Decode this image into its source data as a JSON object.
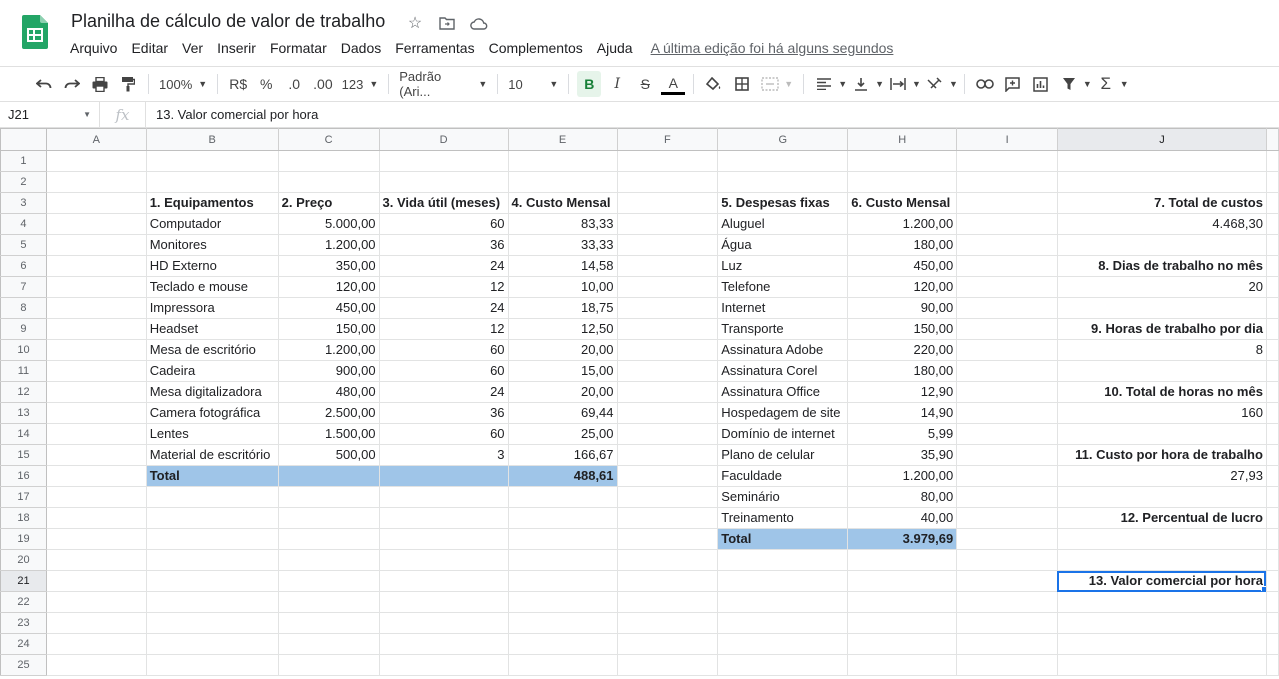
{
  "doc": {
    "title": "Planilha de cálculo de valor de trabalho",
    "last_edit": "A última edição foi há alguns segundos"
  },
  "menu": [
    "Arquivo",
    "Editar",
    "Ver",
    "Inserir",
    "Formatar",
    "Dados",
    "Ferramentas",
    "Complementos",
    "Ajuda"
  ],
  "toolbar": {
    "zoom": "100%",
    "currency": "R$",
    "percent": "%",
    "dec_less": ".0",
    "dec_more": ".00",
    "more_formats": "123",
    "font": "Padrão (Ari...",
    "font_size": "10",
    "bold": "B",
    "italic": "I",
    "strike": "S",
    "text_color": "A",
    "colors": {
      "accent": "#1a73e8",
      "total_fill": "#9fc5e8",
      "bold_active": "#188038"
    }
  },
  "formula_bar": {
    "cell_ref": "J21",
    "fx": "fx",
    "content": "13. Valor comercial por hora"
  },
  "columns": [
    "A",
    "B",
    "C",
    "D",
    "E",
    "F",
    "G",
    "H",
    "I",
    "J"
  ],
  "rows": [
    [
      "",
      "",
      "",
      "",
      "",
      "",
      "",
      "",
      "",
      ""
    ],
    [
      "",
      "",
      "",
      "",
      "",
      "",
      "",
      "",
      "",
      ""
    ],
    [
      "",
      "1. Equipamentos",
      "2. Preço",
      "3. Vida útil (meses)",
      "4. Custo Mensal",
      "",
      "5. Despesas fixas",
      "6. Custo Mensal",
      "",
      "7. Total de custos"
    ],
    [
      "",
      "Computador",
      "5.000,00",
      "60",
      "83,33",
      "",
      "Aluguel",
      "1.200,00",
      "",
      "4.468,30"
    ],
    [
      "",
      "Monitores",
      "1.200,00",
      "36",
      "33,33",
      "",
      "Água",
      "180,00",
      "",
      ""
    ],
    [
      "",
      "HD Externo",
      "350,00",
      "24",
      "14,58",
      "",
      "Luz",
      "450,00",
      "",
      "8. Dias de trabalho no mês"
    ],
    [
      "",
      "Teclado e mouse",
      "120,00",
      "12",
      "10,00",
      "",
      "Telefone",
      "120,00",
      "",
      "20"
    ],
    [
      "",
      "Impressora",
      "450,00",
      "24",
      "18,75",
      "",
      "Internet",
      "90,00",
      "",
      ""
    ],
    [
      "",
      "Headset",
      "150,00",
      "12",
      "12,50",
      "",
      "Transporte",
      "150,00",
      "",
      "9. Horas de trabalho por dia"
    ],
    [
      "",
      "Mesa de escritório",
      "1.200,00",
      "60",
      "20,00",
      "",
      "Assinatura Adobe",
      "220,00",
      "",
      "8"
    ],
    [
      "",
      "Cadeira",
      "900,00",
      "60",
      "15,00",
      "",
      "Assinatura Corel",
      "180,00",
      "",
      ""
    ],
    [
      "",
      "Mesa digitalizadora",
      "480,00",
      "24",
      "20,00",
      "",
      "Assinatura Office",
      "12,90",
      "",
      "10. Total de horas no mês"
    ],
    [
      "",
      "Camera fotográfica",
      "2.500,00",
      "36",
      "69,44",
      "",
      "Hospedagem de site",
      "14,90",
      "",
      "160"
    ],
    [
      "",
      "Lentes",
      "1.500,00",
      "60",
      "25,00",
      "",
      "Domínio de internet",
      "5,99",
      "",
      ""
    ],
    [
      "",
      "Material de escritório",
      "500,00",
      "3",
      "166,67",
      "",
      "Plano de celular",
      "35,90",
      "",
      "11. Custo por hora de trabalho"
    ],
    [
      "",
      "Total",
      "",
      "",
      "488,61",
      "",
      "Faculdade",
      "1.200,00",
      "",
      "27,93"
    ],
    [
      "",
      "",
      "",
      "",
      "",
      "",
      "Seminário",
      "80,00",
      "",
      ""
    ],
    [
      "",
      "",
      "",
      "",
      "",
      "",
      "Treinamento",
      "40,00",
      "",
      "12. Percentual de lucro"
    ],
    [
      "",
      "",
      "",
      "",
      "",
      "",
      "Total",
      "3.979,69",
      "",
      ""
    ],
    [
      "",
      "",
      "",
      "",
      "",
      "",
      "",
      "",
      "",
      ""
    ],
    [
      "",
      "",
      "",
      "",
      "",
      "",
      "",
      "",
      "",
      "13. Valor comercial por hora"
    ],
    [
      "",
      "",
      "",
      "",
      "",
      "",
      "",
      "",
      "",
      ""
    ],
    [
      "",
      "",
      "",
      "",
      "",
      "",
      "",
      "",
      "",
      ""
    ],
    [
      "",
      "",
      "",
      "",
      "",
      "",
      "",
      "",
      "",
      ""
    ],
    [
      "",
      "",
      "",
      "",
      "",
      "",
      "",
      "",
      "",
      ""
    ]
  ]
}
